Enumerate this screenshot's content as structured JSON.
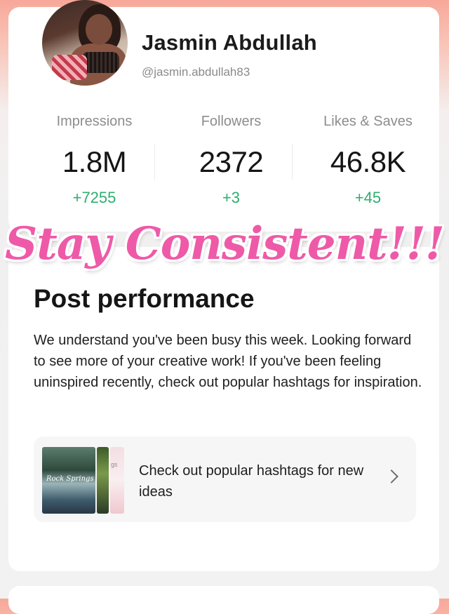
{
  "profile": {
    "name": "Jasmin Abdullah",
    "handle": "@jasmin.abdullah83"
  },
  "stats": [
    {
      "label": "Impressions",
      "value": "1.8M",
      "delta": "+7255"
    },
    {
      "label": "Followers",
      "value": "2372",
      "delta": "+3"
    },
    {
      "label": "Likes & Saves",
      "value": "46.8K",
      "delta": "+45"
    }
  ],
  "overlay_text": "Stay Consistent!!!",
  "post_performance": {
    "title": "Post performance",
    "message": "We understand you've been busy this week. Looking forward to see more of your creative work! If you've been feeling uninspired recently, check out popular hashtags for inspiration.",
    "hashtag_card": {
      "text": "Check out popular hashtags for new ideas",
      "thumb_caption": "Rock Springs",
      "thumb_side_text": "gs"
    }
  },
  "colors": {
    "accent_pink": "#ee5aa8",
    "delta_green": "#2fae6f",
    "header_gradient_top": "#f7a89a"
  },
  "icons": {
    "chevron": "chevron-right-icon"
  }
}
